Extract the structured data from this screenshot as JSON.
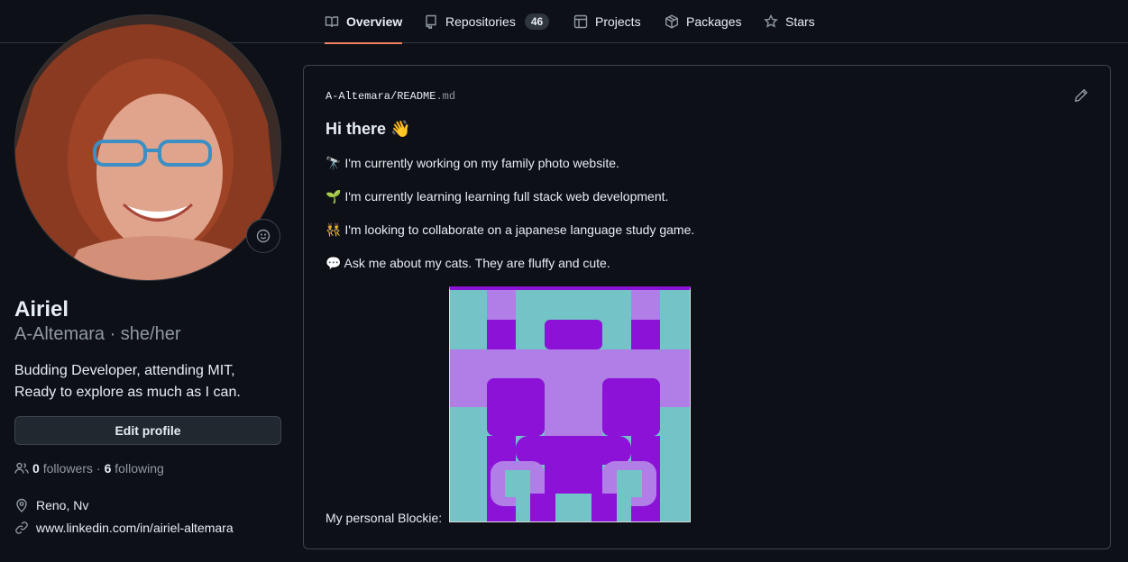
{
  "nav": {
    "tabs": [
      {
        "label": "Overview",
        "icon": "book-icon",
        "active": true
      },
      {
        "label": "Repositories",
        "icon": "repo-icon",
        "count": "46"
      },
      {
        "label": "Projects",
        "icon": "table-icon"
      },
      {
        "label": "Packages",
        "icon": "package-icon"
      },
      {
        "label": "Stars",
        "icon": "star-icon"
      }
    ]
  },
  "profile": {
    "name": "Airiel",
    "login_line": "A-Altemara · she/her",
    "bio_line1": "Budding Developer, attending MIT,",
    "bio_line2": "Ready to explore as much as I can.",
    "edit_label": "Edit profile",
    "followers_count": "0",
    "followers_label": "followers",
    "sep": "·",
    "following_count": "6",
    "following_label": "following",
    "location": "Reno, Nv",
    "website": "www.linkedin.com/in/airiel-altemara"
  },
  "readme": {
    "owner": "A-Altemara",
    "slash": "/",
    "file": "README",
    "ext": ".md",
    "heading": "Hi there 👋",
    "lines": [
      "🔭 I'm currently working on my family photo website.",
      "🌱 I'm currently learning learning full stack web development.",
      "👯 I'm looking to collaborate on a japanese language study game.",
      "💬 Ask me about my cats. They are fluffy and cute."
    ],
    "blockie_label": "My personal Blockie:"
  },
  "colors": {
    "accent": "#f78166",
    "bg": "#0d1117",
    "border": "#3d444d",
    "blockie_teal": "#72c4c6",
    "blockie_purple": "#8b12d6",
    "blockie_lilac": "#b07ee6"
  }
}
